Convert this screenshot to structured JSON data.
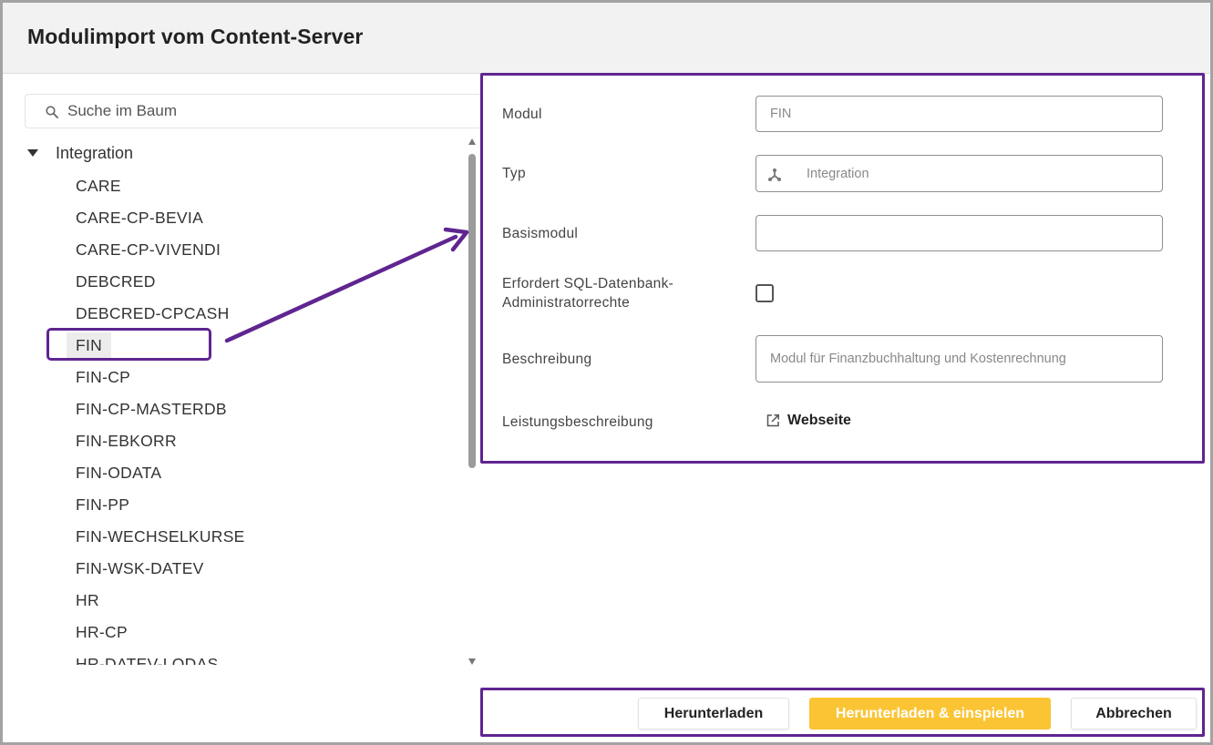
{
  "dialog": {
    "title": "Modulimport vom Content-Server"
  },
  "search": {
    "placeholder": "Suche im Baum",
    "icon": "search-icon"
  },
  "tree": {
    "root_label": "Integration",
    "items": [
      {
        "label": "CARE"
      },
      {
        "label": "CARE-CP-BEVIA"
      },
      {
        "label": "CARE-CP-VIVENDI"
      },
      {
        "label": "DEBCRED"
      },
      {
        "label": "DEBCRED-CPCASH"
      },
      {
        "label": "FIN",
        "selected": true
      },
      {
        "label": "FIN-CP"
      },
      {
        "label": "FIN-CP-MASTERDB"
      },
      {
        "label": "FIN-EBKORR"
      },
      {
        "label": "FIN-ODATA"
      },
      {
        "label": "FIN-PP"
      },
      {
        "label": "FIN-WECHSELKURSE"
      },
      {
        "label": "FIN-WSK-DATEV"
      },
      {
        "label": "HR"
      },
      {
        "label": "HR-CP"
      },
      {
        "label": "HR-DATEV-LODAS"
      }
    ]
  },
  "form": {
    "module_label": "Modul",
    "module_value": "FIN",
    "type_label": "Typ",
    "type_value": "Integration",
    "type_icon": "hierarchy-icon",
    "base_module_label": "Basismodul",
    "base_module_value": "",
    "sql_admin_label_line1": "Erfordert SQL-Datenbank-",
    "sql_admin_label_line2": "Administratorrechte",
    "sql_admin_checked": false,
    "description_label": "Beschreibung",
    "description_value": "Modul für Finanzbuchhaltung und Kostenrechnung",
    "service_description_label": "Leistungsbeschreibung",
    "service_description_link": "Webseite",
    "link_icon": "open-external-icon"
  },
  "footer": {
    "download_label": "Herunterladen",
    "download_install_label": "Herunterladen & einspielen",
    "cancel_label": "Abbrechen"
  },
  "colors": {
    "accent_primary": "#fbc434",
    "annotation": "#5f2590",
    "title_bar": "#f2f2f2"
  }
}
